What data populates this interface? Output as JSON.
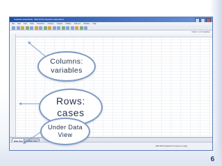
{
  "window": {
    "title": "Untitled1 [DataSet0] - IBM SPSS Statistics Data Editor",
    "menu": [
      "File",
      "Edit",
      "View",
      "Data",
      "Transform",
      "Analyze",
      "Graphs",
      "Utilities",
      "Add-ons",
      "Window",
      "Help"
    ],
    "visible_text": "Visible: 0 of 0 Variables",
    "tabs": [
      {
        "label": "Data View",
        "active": true
      },
      {
        "label": "Variable View",
        "active": false
      }
    ],
    "status": "IBM SPSS Statistics Processor is ready"
  },
  "callouts": {
    "columns": {
      "line1": "Columns:",
      "line2": "variables"
    },
    "rows": {
      "line1": "Rows:",
      "line2": "cases"
    },
    "under": {
      "line1": "Under Data",
      "line2": "View"
    }
  },
  "page_number": "6",
  "colors": {
    "accent": "#7f9ac4",
    "title_bar": "#1f4fa8",
    "text": "#1f2f4a"
  }
}
